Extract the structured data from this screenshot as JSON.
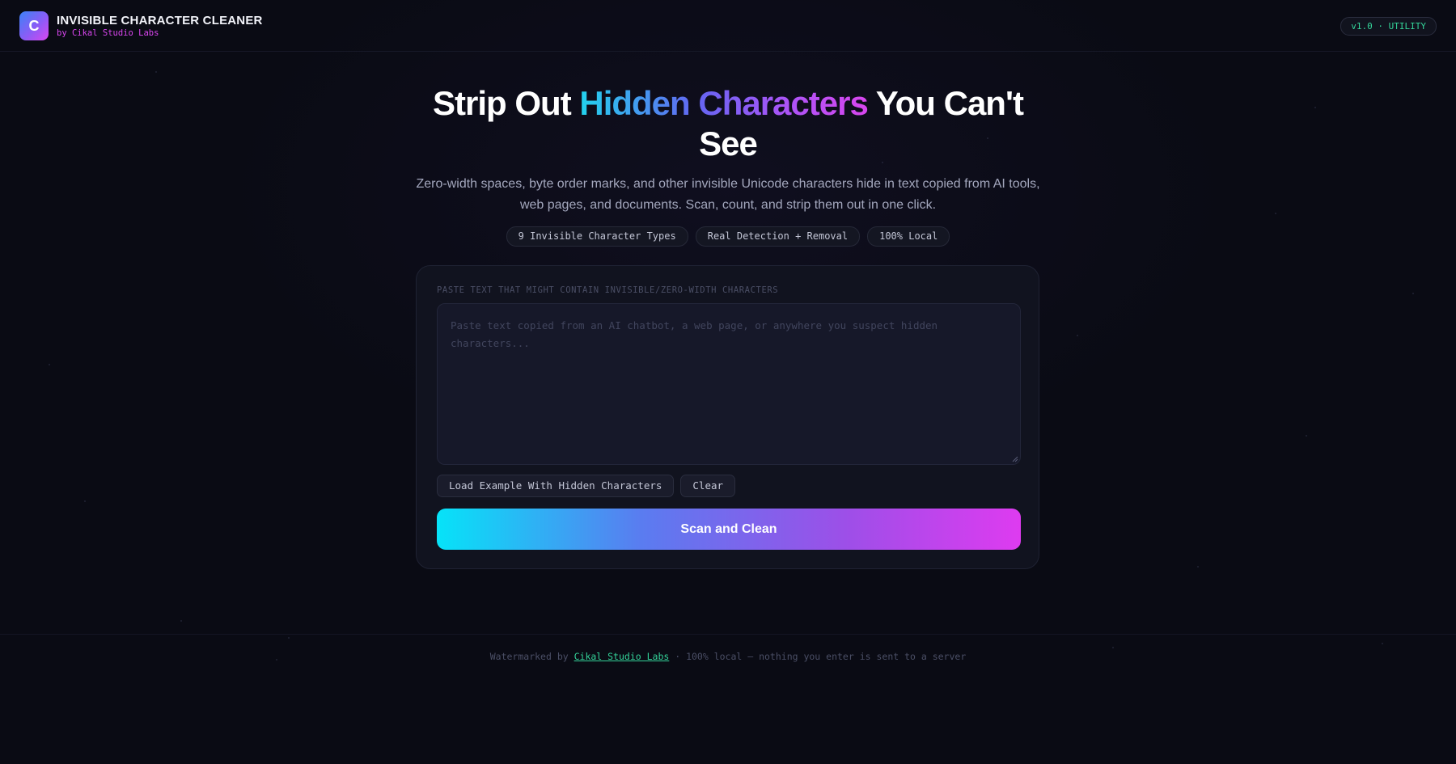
{
  "header": {
    "logo_letter": "C",
    "title": "INVISIBLE CHARACTER CLEANER",
    "subtitle": "by Cikal Studio Labs",
    "version_badge": "v1.0 · UTILITY"
  },
  "hero": {
    "title_before": "Strip Out ",
    "title_highlight": "Hidden Characters",
    "title_after": " You Can't See",
    "description": "Zero-width spaces, byte order marks, and other invisible Unicode characters hide in text copied from AI tools, web pages, and documents. Scan, count, and strip them out in one click.",
    "pills": [
      "9 Invisible Character Types",
      "Real Detection + Removal",
      "100% Local"
    ]
  },
  "tool": {
    "label": "PASTE TEXT THAT MIGHT CONTAIN INVISIBLE/ZERO-WIDTH CHARACTERS",
    "input_value": "",
    "input_placeholder": "Paste text copied from an AI chatbot, a web page, or anywhere you suspect hidden characters...",
    "load_example_label": "Load Example With Hidden Characters",
    "clear_label": "Clear",
    "scan_button_label": "Scan and Clean"
  },
  "footer": {
    "prefix": "Watermarked by ",
    "link_text": "Cikal Studio Labs",
    "suffix": " · 100% local — nothing you enter is sent to a server"
  },
  "colors": {
    "background": "#0a0b14",
    "card": "#11131f",
    "accent_cyan": "#06e3f8",
    "accent_magenta": "#de3bf0",
    "brand_sub": "#d946ef",
    "badge_green": "#34d399"
  }
}
